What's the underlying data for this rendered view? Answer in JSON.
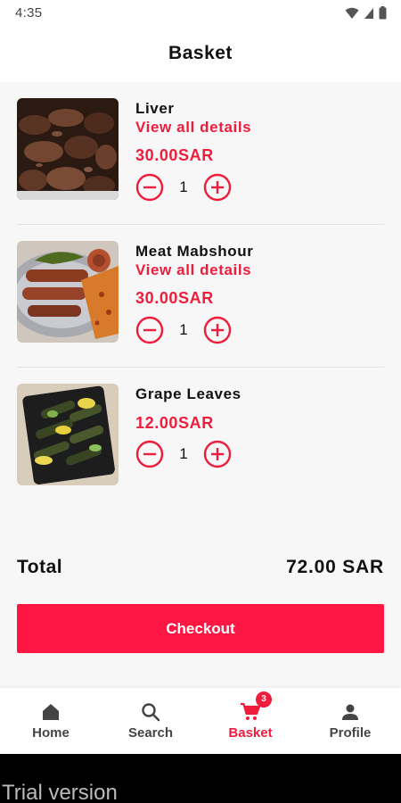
{
  "status_bar": {
    "time": "4:35",
    "icons": [
      "wifi-icon",
      "signal-icon",
      "battery-icon"
    ]
  },
  "header": {
    "title": "Basket"
  },
  "items": [
    {
      "name": "Liver",
      "details_link": "View all details",
      "price": "30.00SAR",
      "quantity": "1",
      "image": "liver-dish"
    },
    {
      "name": "Meat Mabshour",
      "details_link": "View all details",
      "price": "30.00SAR",
      "quantity": "1",
      "image": "kebab-platter"
    },
    {
      "name": "Grape Leaves",
      "price": "12.00SAR",
      "quantity": "1",
      "image": "stuffed-grape-leaves-tray"
    }
  ],
  "summary": {
    "total_label": "Total",
    "total_value": "72.00 SAR"
  },
  "checkout": {
    "label": "Checkout"
  },
  "nav": {
    "items": [
      {
        "label": "Home",
        "icon": "home-icon"
      },
      {
        "label": "Search",
        "icon": "search-icon"
      },
      {
        "label": "Basket",
        "icon": "cart-icon",
        "badge": "3",
        "active": true
      },
      {
        "label": "Profile",
        "icon": "person-icon"
      }
    ]
  },
  "trial": {
    "text": "Trial version"
  },
  "colors": {
    "accent": "#ee1d3c",
    "checkout_bg": "#ff1744",
    "background": "#f7f7f7"
  }
}
